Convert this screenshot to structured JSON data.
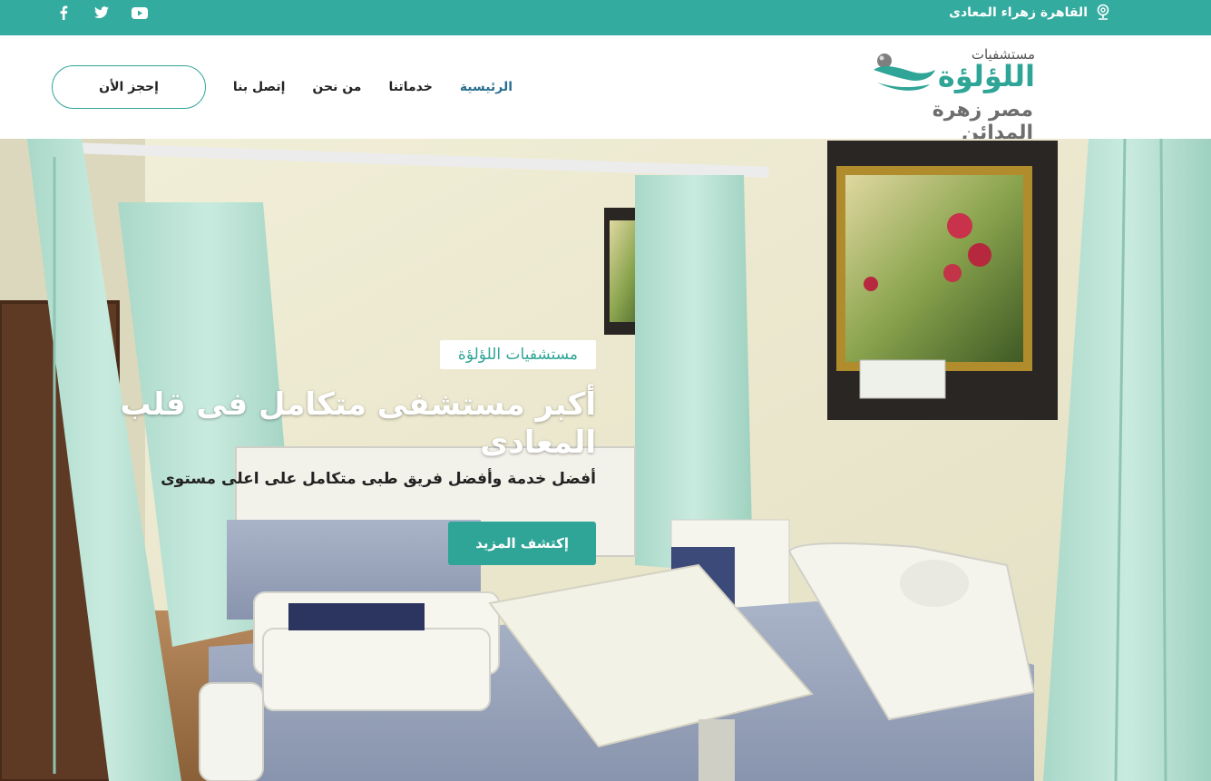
{
  "topbar": {
    "location": "القاهرة زهراء المعادى",
    "socials": [
      "facebook-icon",
      "twitter-icon",
      "youtube-icon"
    ]
  },
  "header": {
    "logo": {
      "small": "مستشفيات",
      "main": "اللؤلؤة",
      "sub": "مصر زهرة المدائن"
    },
    "nav": [
      {
        "label": "الرئيسية",
        "active": true
      },
      {
        "label": "خدماتنا",
        "active": false
      },
      {
        "label": "من نحن",
        "active": false
      },
      {
        "label": "إتصل بنا",
        "active": false
      }
    ],
    "book_button": "إحجز الأن"
  },
  "hero": {
    "badge": "مستشفيات اللؤلؤة",
    "title": "أكبر مستشفى متكامل فى قلب المعادى",
    "subtitle": "أفضل خدمة وأفضل فريق طبى متكامل على اعلى مستوى",
    "cta": "إكتشف المزيد"
  },
  "colors": {
    "accent": "#34ab9f",
    "nav_active": "#2a6f8f"
  }
}
